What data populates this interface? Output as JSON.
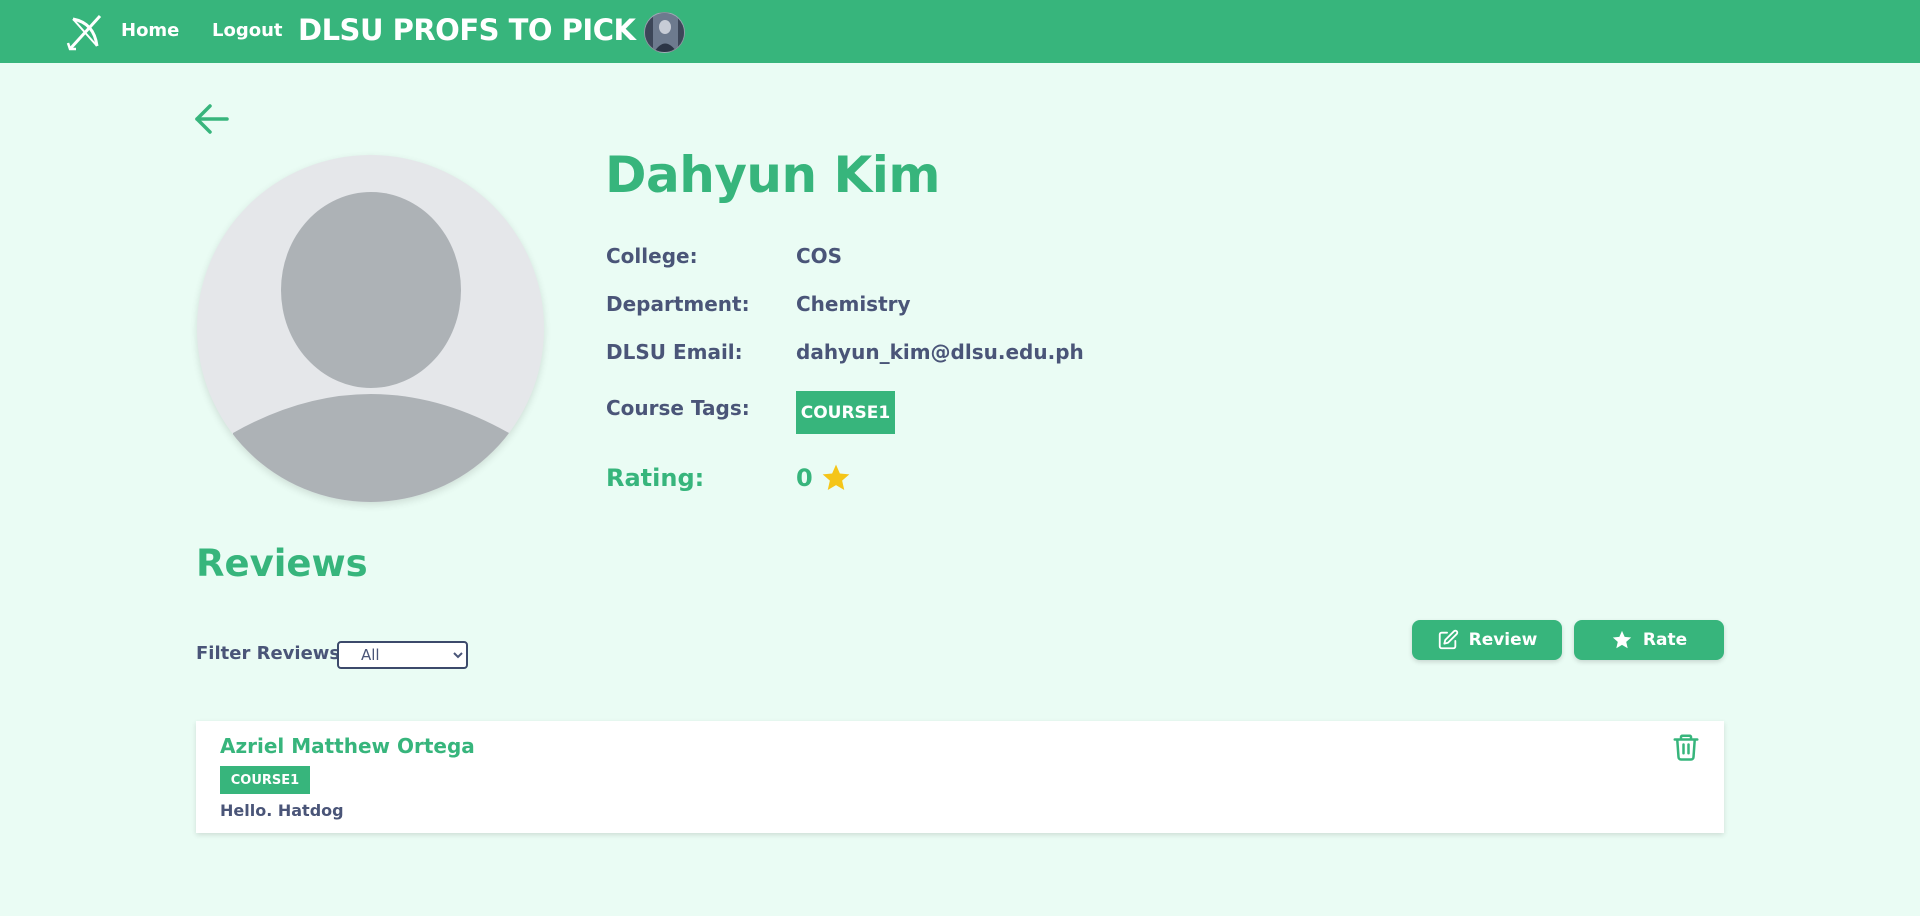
{
  "header": {
    "home_label": "Home",
    "logout_label": "Logout",
    "site_title": "DLSU PROFS TO PICK"
  },
  "profile": {
    "name": "Dahyun Kim",
    "college_label": "College:",
    "college": "COS",
    "department_label": "Department:",
    "department": "Chemistry",
    "email_label": "DLSU Email:",
    "email": "dahyun_kim@dlsu.edu.ph",
    "course_tags_label": "Course Tags:",
    "course_tags": [
      "COURSE1"
    ],
    "rating_label": "Rating:",
    "rating": "0"
  },
  "reviews": {
    "title": "Reviews",
    "filter_label": "Filter Reviews:",
    "filter_selected": "All",
    "review_button": "Review",
    "rate_button": "Rate",
    "items": [
      {
        "author": "Azriel Matthew Ortega",
        "course": "COURSE1",
        "text": "Hello. Hatdog"
      }
    ]
  },
  "icons": {
    "logo": "crossed-bow-logo-icon",
    "back": "arrow-left-icon",
    "star": "star-icon",
    "edit": "pencil-square-icon",
    "delete": "trash-icon"
  },
  "colors": {
    "primary": "#37b57c",
    "background": "#eafcf4",
    "text": "#4a5578",
    "star": "#f5c518"
  }
}
